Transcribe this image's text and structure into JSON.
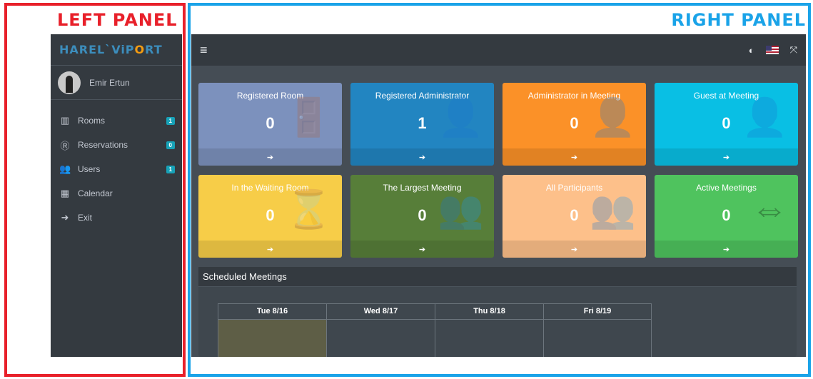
{
  "annotations": {
    "left": "LEFT PANEL",
    "right": "RIGHT PANEL"
  },
  "brand": {
    "part1": "HAREL`ViP",
    "part2": "O",
    "part3": "RT"
  },
  "user": {
    "name": "Emir Ertun"
  },
  "sidebar": {
    "items": [
      {
        "label": "Rooms",
        "icon": "rooms-icon",
        "badge": "1"
      },
      {
        "label": "Reservations",
        "icon": "reservations-icon",
        "badge": "0"
      },
      {
        "label": "Users",
        "icon": "users-icon",
        "badge": "1"
      },
      {
        "label": "Calendar",
        "icon": "calendar-icon",
        "badge": ""
      },
      {
        "label": "Exit",
        "icon": "exit-icon",
        "badge": ""
      }
    ]
  },
  "topbar": {
    "icons": [
      "menu-icon",
      "contrast-icon",
      "flag-us-icon",
      "fullscreen-icon"
    ]
  },
  "cards": [
    {
      "title": "Registered Room",
      "value": "0",
      "color": "#7c91bd",
      "icon": "door-icon"
    },
    {
      "title": "Registered Administrator",
      "value": "1",
      "color": "#2285c1",
      "icon": "user-plus-icon"
    },
    {
      "title": "Administrator in Meeting",
      "value": "0",
      "color": "#fb9128",
      "icon": "user-plus-icon"
    },
    {
      "title": "Guest at Meeting",
      "value": "0",
      "color": "#09bfe4",
      "icon": "user-icon"
    },
    {
      "title": "In the Waiting Room",
      "value": "0",
      "color": "#f7cd48",
      "icon": "hourglass-icon"
    },
    {
      "title": "The Largest Meeting",
      "value": "0",
      "color": "#577e39",
      "icon": "users-icon"
    },
    {
      "title": "All Participants",
      "value": "0",
      "color": "#fdc08a",
      "icon": "users-icon"
    },
    {
      "title": "Active Meetings",
      "value": "0",
      "color": "#4fc35e",
      "icon": "handshake-icon"
    }
  ],
  "scheduled": {
    "title": "Scheduled Meetings",
    "days": [
      "Tue 8/16",
      "Wed 8/17",
      "Thu 8/18",
      "Fri 8/19"
    ]
  }
}
